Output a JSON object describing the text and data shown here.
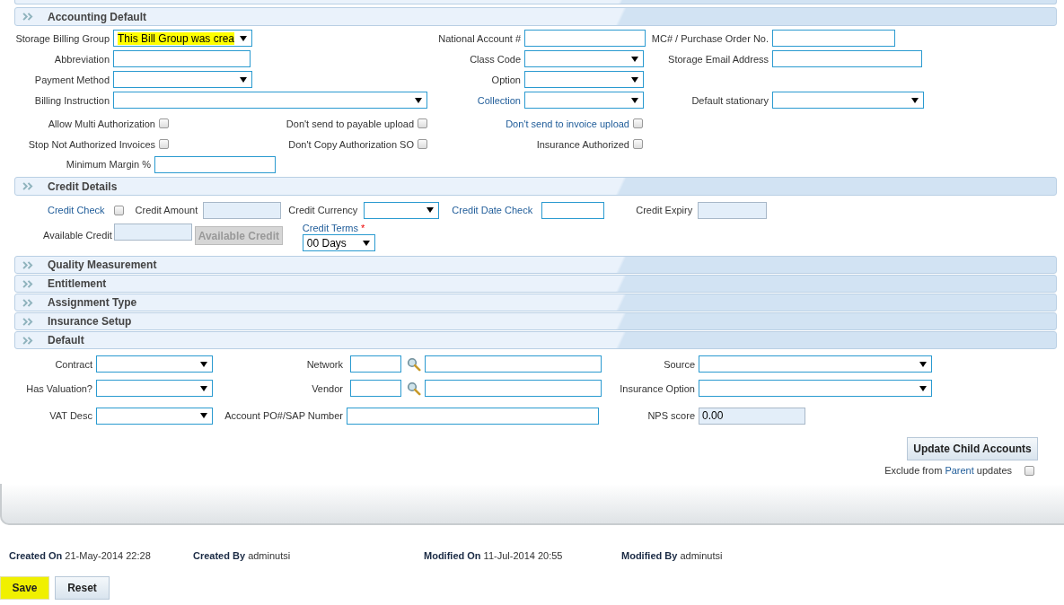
{
  "accounting": {
    "title": "Accounting Default",
    "rows": [
      [
        {
          "label": "Storage Billing Group",
          "kind": "select",
          "value": "This Bill Group was crea",
          "highlighted": true,
          "link": false
        },
        {
          "label": "National Account #",
          "kind": "input",
          "link": false
        },
        {
          "label": "MC# / Purchase Order No.",
          "kind": "input",
          "link": false
        }
      ],
      [
        {
          "label": "Abbreviation",
          "kind": "input",
          "link": false
        },
        {
          "label": "Class Code",
          "kind": "select",
          "link": false
        },
        {
          "label": "Storage Email Address",
          "kind": "input",
          "link": false
        }
      ],
      [
        {
          "label": "Payment Method",
          "kind": "select",
          "link": false
        },
        {
          "label": "Option",
          "kind": "select",
          "link": false
        }
      ],
      [
        {
          "label": "Billing Instruction",
          "kind": "select",
          "link": false
        },
        {
          "label": "Collection",
          "kind": "select",
          "link": true
        },
        {
          "label": "Default stationary",
          "kind": "select",
          "link": false
        }
      ]
    ],
    "checkbox_rows": [
      [
        {
          "label": "Allow Multi Authorization",
          "checked": false,
          "link": false
        },
        {
          "label": "Don't send to payable upload",
          "checked": false,
          "link": false
        },
        {
          "label": "Don't send to invoice upload",
          "checked": false,
          "link": true
        }
      ],
      [
        {
          "label": "Stop Not Authorized Invoices",
          "checked": false,
          "link": false
        },
        {
          "label": "Don't Copy Authorization SO",
          "checked": false,
          "link": false
        },
        {
          "label": "Insurance Authorized",
          "checked": false,
          "link": false
        }
      ]
    ],
    "minimum_margin": {
      "label": "Minimum Margin %"
    }
  },
  "credit": {
    "title": "Credit Details",
    "credit_check": {
      "label": "Credit Check",
      "checked": false,
      "link": true
    },
    "credit_amount": {
      "label": "Credit Amount",
      "link": false
    },
    "credit_currency": {
      "label": "Credit Currency",
      "link": false
    },
    "credit_date_check": {
      "label": "Credit Date Check",
      "link": true
    },
    "credit_expiry": {
      "label": "Credit Expiry",
      "link": false
    },
    "available_credit": {
      "label": "Available Credit",
      "link": false
    },
    "available_credit_button": {
      "label": "Available Credit",
      "disabled": true
    },
    "credit_terms": {
      "label": "Credit Terms",
      "required_mark": "*",
      "value": "00 Days",
      "link": true
    }
  },
  "collapsed_sections": [
    {
      "title": "Quality Measurement"
    },
    {
      "title": "Entitlement"
    },
    {
      "title": "Assignment Type"
    },
    {
      "title": "Insurance Setup"
    }
  ],
  "default": {
    "title": "Default",
    "rows": [
      [
        {
          "label": "Contract",
          "kind": "select"
        },
        {
          "label": "Network",
          "kind": "lookup"
        },
        {
          "label": "Source",
          "kind": "select"
        }
      ],
      [
        {
          "label": "Has Valuation?",
          "kind": "select"
        },
        {
          "label": "Vendor",
          "kind": "lookup"
        },
        {
          "label": "Insurance Option",
          "kind": "select"
        }
      ],
      [
        {
          "label": "VAT Desc",
          "kind": "select"
        },
        {
          "label": "Account PO#/SAP Number",
          "kind": "input"
        },
        {
          "label": "NPS score",
          "kind": "readonly",
          "value": "0.00"
        }
      ]
    ]
  },
  "update_button": {
    "label": "Update Child Accounts"
  },
  "exclude": {
    "text_before": "Exclude from ",
    "link": "Parent",
    "text_after": " updates",
    "checked": false
  },
  "audit": [
    {
      "text": "**Created On** 21-May-2014 22:28"
    },
    {
      "text": "**Created By** adminutsi"
    },
    {
      "text": "**Modified On** 11-Jul-2014 20:55"
    },
    {
      "text": "**Modified By** adminutsi"
    }
  ],
  "buttons": [
    {
      "label": "Save",
      "highlighted": true
    },
    {
      "label": "Reset",
      "highlighted": false
    }
  ]
}
